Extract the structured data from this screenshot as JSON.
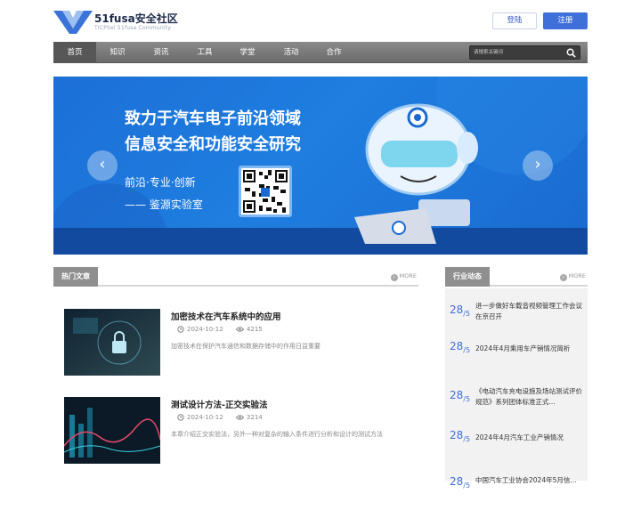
{
  "header": {
    "logo_title": "51fusa安全社区",
    "logo_subtitle": "TICPSel 51fusa Community",
    "login_label": "登陆",
    "register_label": "注册"
  },
  "nav": {
    "items": [
      "首页",
      "知识",
      "资讯",
      "工具",
      "学堂",
      "活动",
      "合作"
    ],
    "active_index": 0,
    "search_placeholder": "请搜索关键词"
  },
  "banner": {
    "line1": "致力于汽车电子前沿领域",
    "line2": "信息安全和功能安全研究",
    "tagline": "前沿·专业·创新",
    "lab": "—— 鉴源实验室",
    "colors": {
      "background": "#1c6fd6",
      "bottom_band": "#114a9f"
    }
  },
  "hot": {
    "title": "热门文章",
    "more": "MORE",
    "articles": [
      {
        "title": "加密技术在汽车系统中的应用",
        "date": "2024-10-12",
        "views": "4215",
        "desc": "加密技术在保护汽车通信和数据存储中的作用日益重要"
      },
      {
        "title": "测试设计方法-正交实验法",
        "date": "2024-10-12",
        "views": "3214",
        "desc": "本章介绍正交实验法，另外一种对复杂的输入条件进行分析和设计的测试方法"
      }
    ]
  },
  "news": {
    "title": "行业动态",
    "more": "MORE",
    "items": [
      {
        "day": "28",
        "month": "5",
        "title": "进一步做好车载音视频管理工作会议在京召开"
      },
      {
        "day": "28",
        "month": "5",
        "title": "2024年4月乘用车产销情况简析"
      },
      {
        "day": "28",
        "month": "5",
        "title": "《电动汽车充电设施及场站测试评价规范》系列团体标准正式..."
      },
      {
        "day": "28",
        "month": "5",
        "title": "2024年4月汽车工业产销情况"
      },
      {
        "day": "28",
        "month": "5",
        "title": "中国汽车工业协会2024年5月信..."
      }
    ]
  },
  "colors": {
    "accent": "#3f6fd9",
    "nav_bg": "#7a7a7a",
    "section_tab": "#8f8f8f"
  }
}
